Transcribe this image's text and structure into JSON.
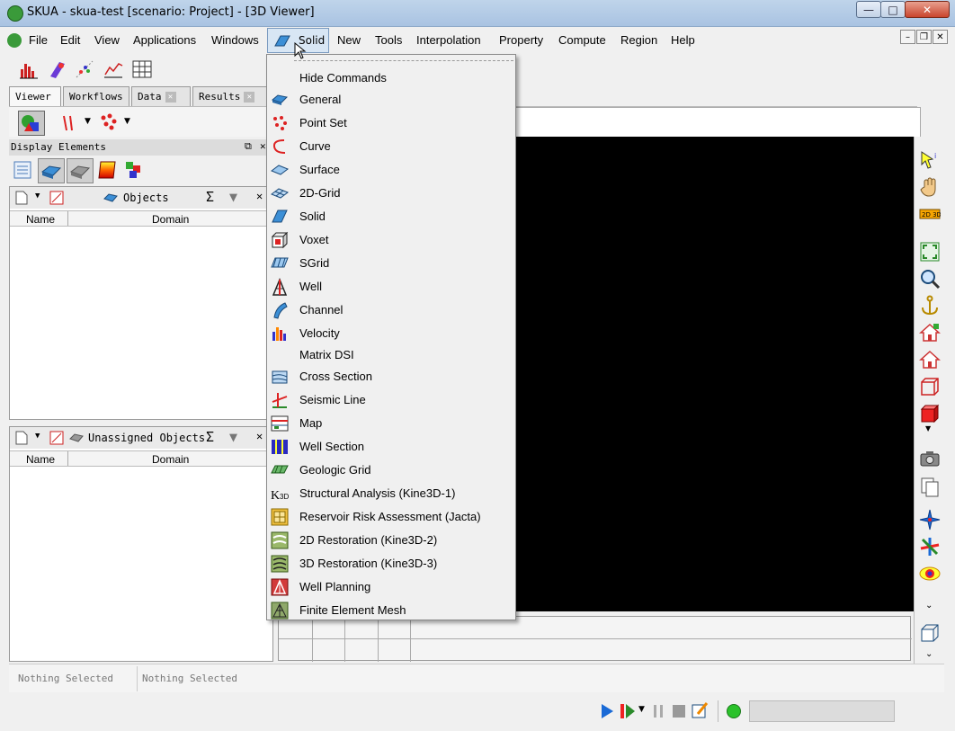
{
  "window": {
    "title": "SKUA - skua-test  [scenario: Project] - [3D Viewer]",
    "minimize": "—",
    "maximize": "□",
    "close": "✕"
  },
  "menubar": {
    "items": [
      "File",
      "Edit",
      "View",
      "Applications",
      "Windows",
      "Solid",
      "New",
      "Tools",
      "Interpolation",
      "Property",
      "Compute",
      "Region",
      "Help"
    ],
    "mdi_min": "–",
    "mdi_restore": "❐",
    "mdi_close": "✕"
  },
  "tabs": [
    {
      "label": "Viewer",
      "closable": false
    },
    {
      "label": "Workflows",
      "closable": false
    },
    {
      "label": "Data",
      "closable": true
    },
    {
      "label": "Results",
      "closable": true
    }
  ],
  "display_elements": {
    "header": "Display Elements"
  },
  "objects_panel": {
    "title": "Objects",
    "columns": [
      "Name",
      "Domain"
    ]
  },
  "unassigned_panel": {
    "title": "Unassigned Objects",
    "columns": [
      "Name",
      "Domain"
    ]
  },
  "status": {
    "left": "Nothing Selected",
    "right": "Nothing Selected"
  },
  "dropdown": {
    "items": [
      {
        "label": "Hide Commands",
        "icon": "none"
      },
      {
        "label": "General",
        "icon": "general-icon"
      },
      {
        "label": "Point Set",
        "icon": "point-set-icon"
      },
      {
        "label": "Curve",
        "icon": "curve-icon"
      },
      {
        "label": "Surface",
        "icon": "surface-icon"
      },
      {
        "label": "2D-Grid",
        "icon": "2d-grid-icon"
      },
      {
        "label": "Solid",
        "icon": "solid-icon"
      },
      {
        "label": "Voxet",
        "icon": "voxet-icon"
      },
      {
        "label": "SGrid",
        "icon": "sgrid-icon"
      },
      {
        "label": "Well",
        "icon": "well-icon"
      },
      {
        "label": "Channel",
        "icon": "channel-icon"
      },
      {
        "label": "Velocity",
        "icon": "velocity-icon"
      },
      {
        "label": "Matrix DSI",
        "icon": "none"
      },
      {
        "label": "Cross Section",
        "icon": "cross-section-icon"
      },
      {
        "label": "Seismic Line",
        "icon": "seismic-line-icon"
      },
      {
        "label": "Map",
        "icon": "map-icon"
      },
      {
        "label": "Well Section",
        "icon": "well-section-icon"
      },
      {
        "label": "Geologic Grid",
        "icon": "geologic-grid-icon"
      },
      {
        "label": "Structural Analysis (Kine3D-1)",
        "icon": "k3d-icon"
      },
      {
        "label": "Reservoir Risk Assessment (Jacta)",
        "icon": "jacta-icon"
      },
      {
        "label": "2D Restoration (Kine3D-2)",
        "icon": "restoration-2d-icon"
      },
      {
        "label": "3D Restoration (Kine3D-3)",
        "icon": "restoration-3d-icon"
      },
      {
        "label": "Well Planning",
        "icon": "well-planning-icon"
      },
      {
        "label": "Finite Element Mesh",
        "icon": "fem-icon"
      }
    ]
  }
}
